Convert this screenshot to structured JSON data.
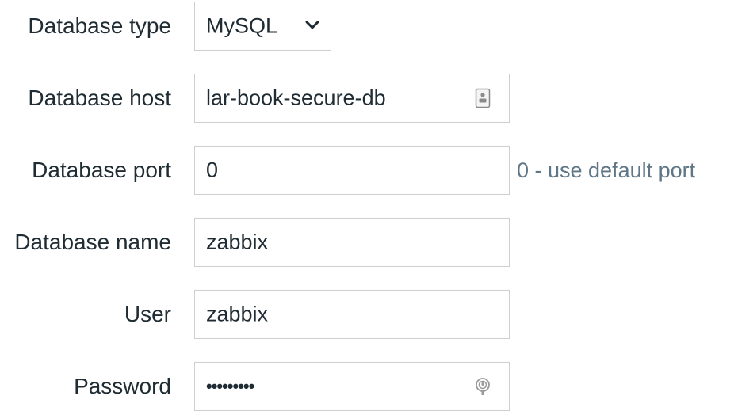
{
  "form": {
    "db_type": {
      "label": "Database type",
      "value": "MySQL"
    },
    "db_host": {
      "label": "Database host",
      "value": "lar-book-secure-db"
    },
    "db_port": {
      "label": "Database port",
      "value": "0",
      "hint": "0 - use default port"
    },
    "db_name": {
      "label": "Database name",
      "value": "zabbix"
    },
    "user": {
      "label": "User",
      "value": "zabbix"
    },
    "password": {
      "label": "Password",
      "value": "•••••••••"
    }
  },
  "colors": {
    "hint": "#5e7686",
    "text": "#1f2c33",
    "border": "#cfcfcf"
  },
  "icons": {
    "select": "chevron-down-icon",
    "host": "contact-card-icon",
    "password": "password-key-icon"
  }
}
